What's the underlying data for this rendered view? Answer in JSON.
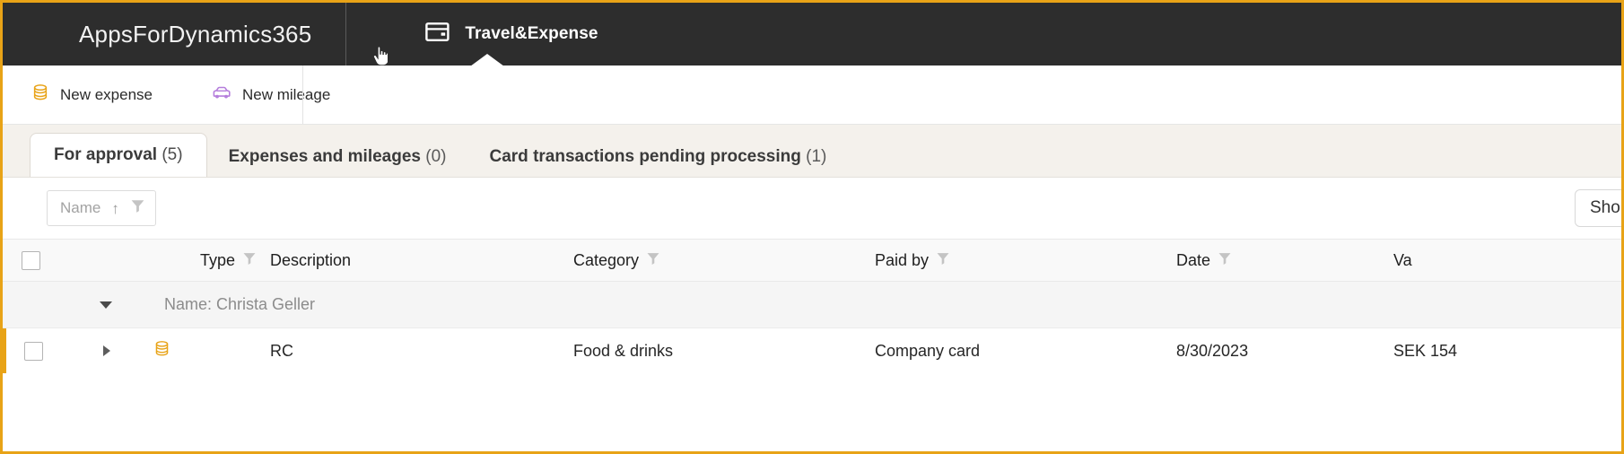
{
  "theme": {
    "accent": "#e8a317",
    "header_bg": "#2d2d2d",
    "tabstrip_bg": "#f4f1ec",
    "mileage_icon_color": "#b57edc"
  },
  "header": {
    "brand": "AppsForDynamics365",
    "app_tab": {
      "label": "Travel&Expense",
      "icon": "wallet-icon",
      "active": true
    }
  },
  "command_bar": {
    "actions": [
      {
        "label": "New expense",
        "icon": "coins-icon"
      },
      {
        "label": "New mileage",
        "icon": "car-icon"
      }
    ]
  },
  "tabs": [
    {
      "title": "For approval",
      "count": "(5)",
      "active": true
    },
    {
      "title": "Expenses and mileages",
      "count": "(0)",
      "active": false
    },
    {
      "title": "Card transactions pending processing",
      "count": "(1)",
      "active": false
    }
  ],
  "filter_bar": {
    "chip": {
      "placeholder": "Name",
      "sort_arrow": "↑",
      "filter_icon": "funnel-icon"
    },
    "show_button": "Sho"
  },
  "table": {
    "columns": [
      {
        "key": "select",
        "label": "",
        "filterable": false
      },
      {
        "key": "expand",
        "label": "",
        "filterable": false
      },
      {
        "key": "type",
        "label": "Type",
        "filterable": true
      },
      {
        "key": "description",
        "label": "Description",
        "filterable": false
      },
      {
        "key": "category",
        "label": "Category",
        "filterable": true
      },
      {
        "key": "paid_by",
        "label": "Paid by",
        "filterable": true
      },
      {
        "key": "date",
        "label": "Date",
        "filterable": true
      },
      {
        "key": "value",
        "label": "Va",
        "filterable": false
      }
    ],
    "group": {
      "label": "Name: Christa Geller",
      "expanded": true
    },
    "rows": [
      {
        "type_icon": "coins-icon",
        "description": "RC",
        "category": "Food & drinks",
        "paid_by": "Company card",
        "date": "8/30/2023",
        "value": "SEK 154"
      }
    ]
  }
}
